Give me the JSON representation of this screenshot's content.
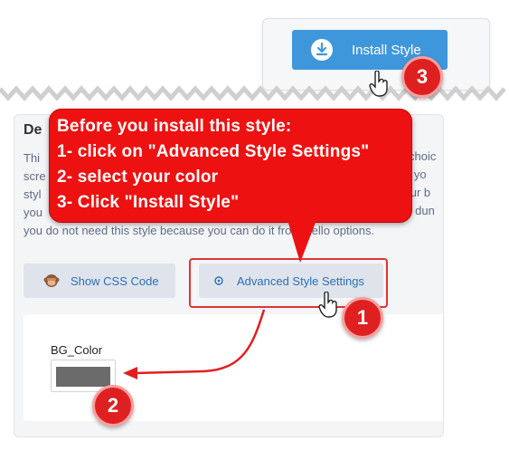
{
  "top_snippet": {
    "install_button_label": "Install Style",
    "icon": "download-icon"
  },
  "panel": {
    "title": "De",
    "description_lines": [
      "Thi",
      "scre",
      "styl",
      "you",
      "you do not need this style because you can do it from trello options."
    ],
    "right_fragments": [
      "choic",
      "le if yo",
      "your b",
      "ur dun"
    ],
    "show_css_button": {
      "label": "Show CSS Code",
      "icon": "monkey-icon"
    },
    "advanced_button": {
      "label": "Advanced Style Settings",
      "icon": "gear-icon"
    },
    "bg_color": {
      "label": "BG_Color",
      "value": "#6b6b6b"
    }
  },
  "callout": {
    "lines": [
      "Before you install this style:",
      "1- click on \"Advanced Style Settings\"",
      "2- select your color",
      "3- Click \"Install Style\""
    ]
  },
  "steps": [
    "1",
    "2",
    "3"
  ],
  "colors": {
    "accent_blue": "#3f97db",
    "callout_red": "#ee1111",
    "badge_red": "#df2020",
    "button_bg": "#dfe4ec",
    "link_blue": "#2e6fb3"
  }
}
